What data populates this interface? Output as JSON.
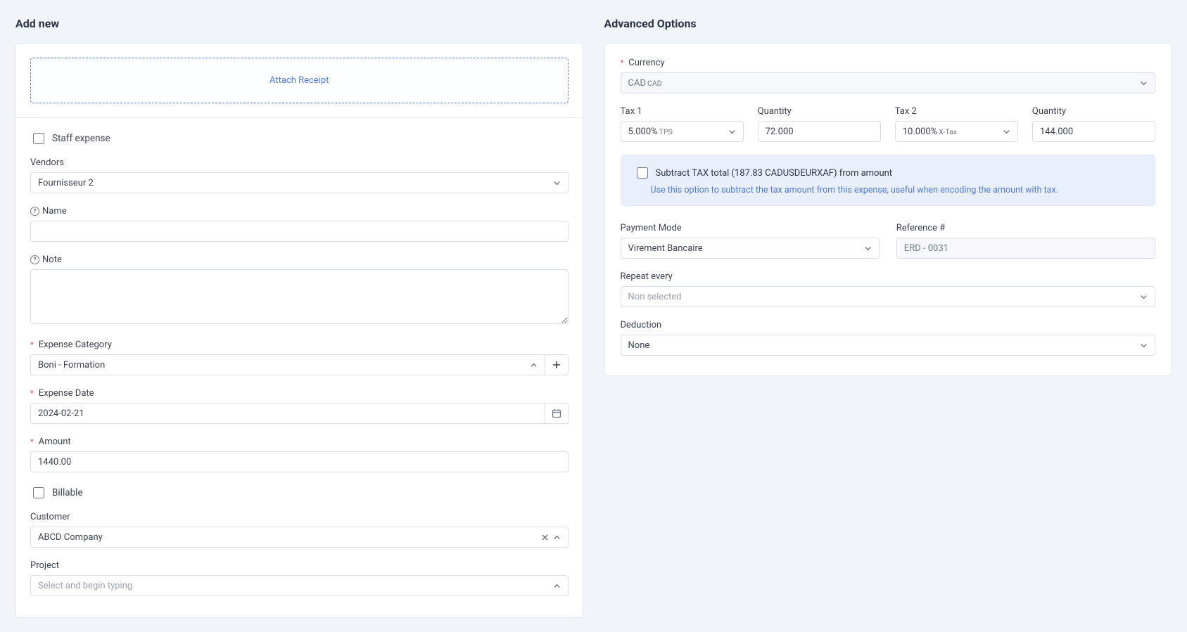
{
  "left": {
    "title": "Add new",
    "attach_receipt": "Attach Receipt",
    "staff_expense_label": "Staff expense",
    "vendors": {
      "label": "Vendors",
      "value": "Fournisseur 2"
    },
    "name": {
      "label": "Name",
      "value": ""
    },
    "note": {
      "label": "Note",
      "value": ""
    },
    "category": {
      "label": "Expense Category",
      "value": "Boni - Formation"
    },
    "date": {
      "label": "Expense Date",
      "value": "2024-02-21"
    },
    "amount": {
      "label": "Amount",
      "value": "1440.00"
    },
    "billable_label": "Billable",
    "customer": {
      "label": "Customer",
      "value": "ABCD Company"
    },
    "project": {
      "label": "Project",
      "placeholder": "Select and begin typing"
    }
  },
  "right": {
    "title": "Advanced Options",
    "currency": {
      "label": "Currency",
      "value": "CAD",
      "sub": "CAD"
    },
    "tax1": {
      "label": "Tax 1",
      "value": "5.000%",
      "sub": "TPS"
    },
    "qty1": {
      "label": "Quantity",
      "value": "72.000"
    },
    "tax2": {
      "label": "Tax 2",
      "value": "10.000%",
      "sub": "X-Tax"
    },
    "qty2": {
      "label": "Quantity",
      "value": "144.000"
    },
    "subtract_label": "Subtract TAX total (187.83 CADUSDEURXAF) from amount",
    "subtract_desc": "Use this option to subtract the tax amount from this expense, useful when encoding the amount with tax.",
    "payment_mode": {
      "label": "Payment Mode",
      "value": "Virement Bancaire"
    },
    "reference": {
      "label": "Reference #",
      "value": "ERD - 0031"
    },
    "repeat": {
      "label": "Repeat every",
      "placeholder": "Non selected"
    },
    "deduction": {
      "label": "Deduction",
      "value": "None"
    }
  }
}
